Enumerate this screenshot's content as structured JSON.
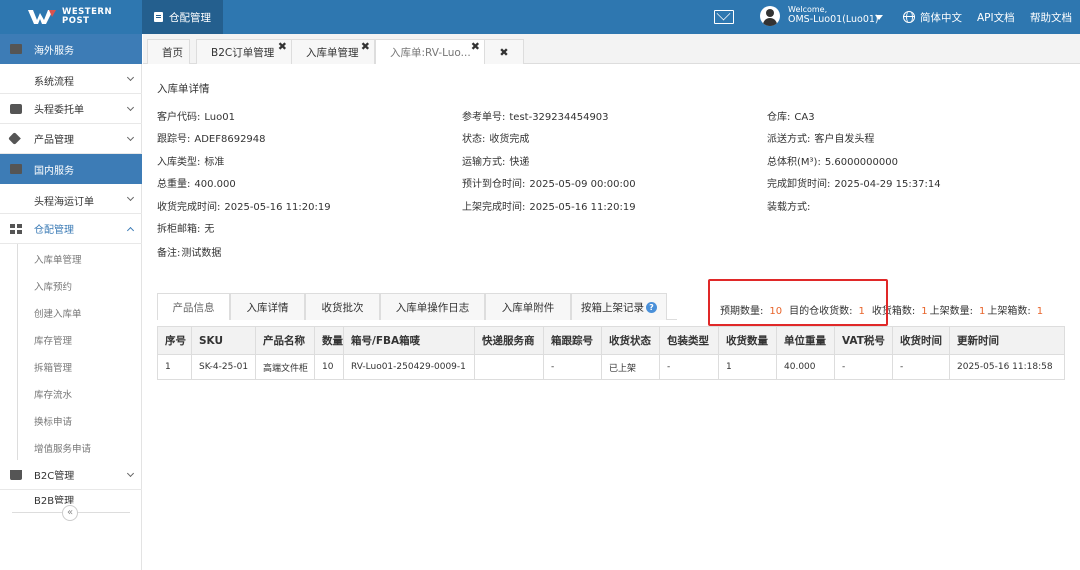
{
  "topbar": {
    "brand_line1": "WESTERN",
    "brand_line2": "POST",
    "nav_label": "仓配管理",
    "welcome": "Welcome,",
    "username": "OMS-Luo01(Luo01)",
    "language": "简体中文",
    "api_docs": "API文档",
    "help_docs": "帮助文档"
  },
  "sidebar": {
    "overseas": "海外服务",
    "system_flow": "系统流程",
    "first_leg_order": "头程委托单",
    "product_mgmt": "产品管理",
    "domestic": "国内服务",
    "first_leg_sea": "头程海运订单",
    "warehouse_mgmt": "仓配管理",
    "leaves": [
      "入库单管理",
      "入库预约",
      "创建入库单",
      "库存管理",
      "拆箱管理",
      "库存流水",
      "换标申请",
      "增值服务申请"
    ],
    "b2c": "B2C管理",
    "b2b": "B2B管理",
    "collapse": "«"
  },
  "tabs": {
    "home": "首页",
    "b2c_orders": "B2C订单管理",
    "inbound_mgmt": "入库单管理",
    "inbound_detail": "入库单:RV-Luo...",
    "close": "✖"
  },
  "detail": {
    "title": "入库单详情",
    "fields": {
      "customer_code_label": "客户代码:",
      "customer_code": "Luo01",
      "ref_no_label": "参考单号:",
      "ref_no": "test-329234454903",
      "warehouse_label": "仓库:",
      "warehouse": "CA3",
      "tracking_label": "跟踪号:",
      "tracking": "ADEF8692948",
      "status_label": "状态:",
      "status": "收货完成",
      "dispatch_label": "派送方式:",
      "dispatch": "客户自发头程",
      "inbound_type_label": "入库类型:",
      "inbound_type": "标准",
      "transport_label": "运输方式:",
      "transport": "快递",
      "volume_label": "总体积(M³):",
      "volume": "5.6000000000",
      "weight_label": "总重量:",
      "weight": "400.000",
      "eta_label": "预计到仓时间:",
      "eta": "2025-05-09 00:00:00",
      "unload_label": "完成卸货时间:",
      "unload": "2025-04-29 15:37:14",
      "received_label": "收货完成时间:",
      "received": "2025-05-16 11:20:19",
      "shelved_label": "上架完成时间:",
      "shelved": "2025-05-16 11:20:19",
      "loading_label": "装载方式:",
      "loading": "",
      "cabinet_label": "拆柜邮箱:",
      "cabinet": "无",
      "remark_label": "备注:",
      "remark": "测试数据"
    }
  },
  "detail_tabs": [
    "产品信息",
    "入库详情",
    "收货批次",
    "入库单操作日志",
    "入库单附件",
    "按箱上架记录"
  ],
  "counts": {
    "expected_label": "预期数量:",
    "expected": "10",
    "dest_received_label": "目的仓收货数:",
    "dest_received": "1",
    "recv_boxes_label": "收货箱数:",
    "recv_boxes": "1",
    "shelved_qty_label": "上架数量:",
    "shelved_qty": "1",
    "shelved_boxes_label": "上架箱数:",
    "shelved_boxes": "1"
  },
  "table": {
    "headers": [
      "序号",
      "SKU",
      "产品名称",
      "数量",
      "箱号/FBA箱唛",
      "快递服务商",
      "箱跟踪号",
      "收货状态",
      "包装类型",
      "收货数量",
      "单位重量",
      "VAT税号",
      "收货时间",
      "更新时间"
    ],
    "rows": [
      [
        "1",
        "SK-4-25-01",
        "高端文件柜",
        "10",
        "RV-Luo01-250429-0009-1",
        "",
        "-",
        "已上架",
        "-",
        "1",
        "40.000",
        "-",
        "-",
        "2025-05-16 11:18:58"
      ]
    ]
  }
}
